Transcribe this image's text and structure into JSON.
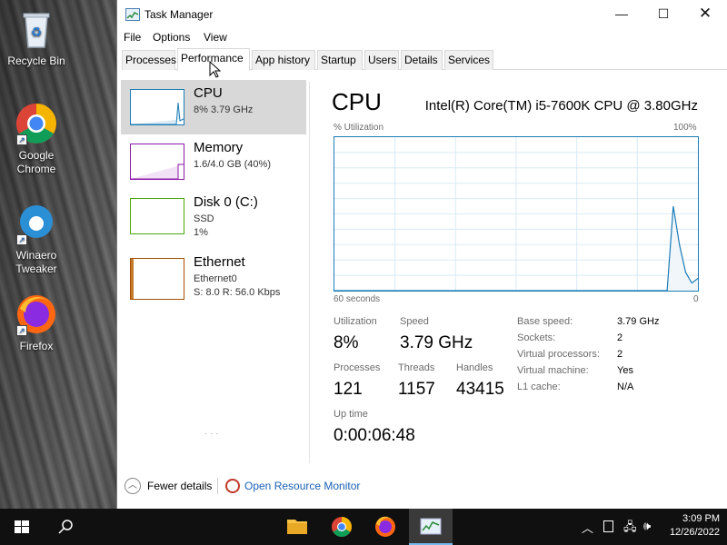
{
  "desktop": {
    "icons": [
      {
        "label": "Recycle Bin",
        "icon": "recycle-bin-icon"
      },
      {
        "label": "Google\nChrome",
        "icon": "chrome-icon"
      },
      {
        "label": "Winaero\nTweaker",
        "icon": "winaero-tweaker-icon"
      },
      {
        "label": "Firefox",
        "icon": "firefox-icon"
      }
    ]
  },
  "window": {
    "title": "Task Manager",
    "menu": [
      "File",
      "Options",
      "View"
    ],
    "tabs": [
      "Processes",
      "Performance",
      "App history",
      "Startup",
      "Users",
      "Details",
      "Services"
    ],
    "active_tab": "Performance"
  },
  "sidebar": {
    "items": [
      {
        "name": "CPU",
        "line1": "8% 3.79 GHz",
        "line2": "",
        "line3": "",
        "color": "#1b7cb6"
      },
      {
        "name": "Memory",
        "line1": "1.6/4.0 GB (40%)",
        "line2": "",
        "line3": "",
        "color": "#8b17a8"
      },
      {
        "name": "Disk 0 (C:)",
        "line1": "SSD",
        "line2": "1%",
        "line3": "",
        "color": "#4da60c"
      },
      {
        "name": "Ethernet",
        "line1": "Ethernet0",
        "line2": "S: 8.0 R: 56.0 Kbps",
        "line3": "",
        "color": "#a74f01"
      }
    ]
  },
  "detail": {
    "title": "CPU",
    "model": "Intel(R) Core(TM) i5-7600K CPU @ 3.80GHz",
    "graph_label": "% Utilization",
    "graph_max": "100%",
    "graph_time": "60 seconds",
    "graph_min": "0",
    "utilization_series": [
      0,
      0,
      0,
      0,
      0,
      0,
      0,
      0,
      0,
      0,
      0,
      0,
      0,
      0,
      0,
      0,
      0,
      0,
      0,
      0,
      0,
      0,
      0,
      0,
      0,
      0,
      0,
      0,
      0,
      0,
      0,
      0,
      0,
      0,
      0,
      0,
      0,
      0,
      0,
      0,
      0,
      0,
      0,
      0,
      0,
      0,
      0,
      0,
      0,
      0,
      0,
      0,
      0,
      0,
      0,
      55,
      30,
      12,
      5,
      8
    ],
    "stats": {
      "utilization_label": "Utilization",
      "utilization": "8%",
      "speed_label": "Speed",
      "speed": "3.79 GHz",
      "processes_label": "Processes",
      "processes": "121",
      "threads_label": "Threads",
      "threads": "1157",
      "handles_label": "Handles",
      "handles": "43415",
      "uptime_label": "Up time",
      "uptime": "0:00:06:48"
    },
    "specs": [
      {
        "label": "Base speed:",
        "value": "3.79 GHz"
      },
      {
        "label": "Sockets:",
        "value": "2"
      },
      {
        "label": "Virtual processors:",
        "value": "2"
      },
      {
        "label": "Virtual machine:",
        "value": "Yes"
      },
      {
        "label": "L1 cache:",
        "value": "N/A"
      }
    ]
  },
  "footer": {
    "fewer_details": "Fewer details",
    "open_resource_monitor": "Open Resource Monitor"
  },
  "taskbar": {
    "time": "3:09 PM",
    "date": "12/26/2022",
    "pinned": [
      "file-explorer-icon",
      "chrome-icon",
      "firefox-icon",
      "task-manager-icon"
    ],
    "colors": {
      "background": "#101010",
      "accent": "#1b7cb6"
    }
  }
}
